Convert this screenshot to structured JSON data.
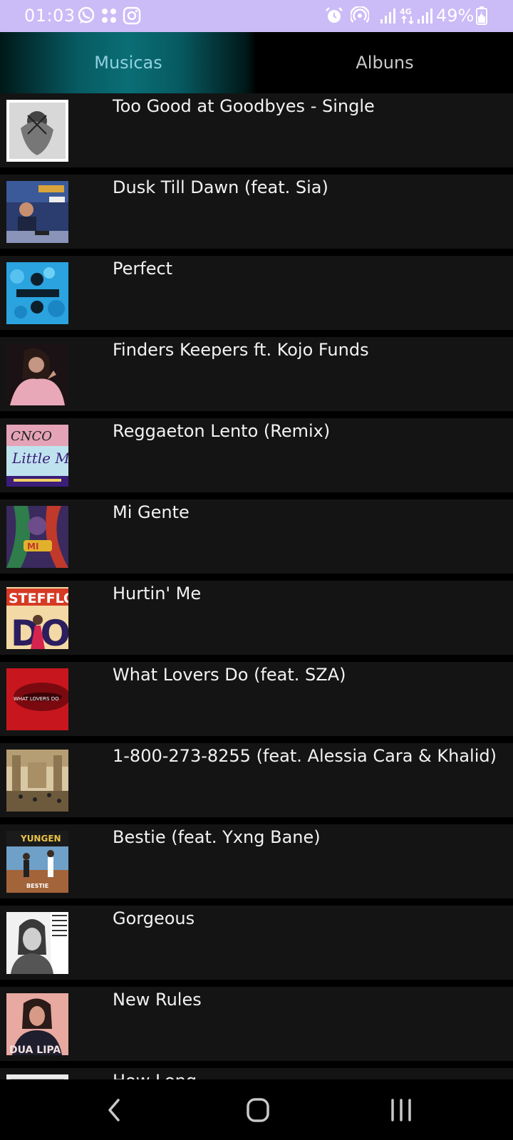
{
  "status_bar": {
    "time": "01:03",
    "battery": "49%",
    "icons": [
      "whatsapp-icon",
      "apps-icon",
      "instagram-icon",
      "alarm-icon",
      "hotspot-icon",
      "signal-icon",
      "4g-icon",
      "signal-icon",
      "battery-icon"
    ]
  },
  "tabs": [
    {
      "label": "Musicas",
      "selected": true
    },
    {
      "label": "Albuns",
      "selected": false
    }
  ],
  "songs": [
    {
      "title": "Too Good at Goodbyes - Single"
    },
    {
      "title": "Dusk Till Dawn (feat. Sia)"
    },
    {
      "title": "Perfect"
    },
    {
      "title": "Finders Keepers ft. Kojo Funds"
    },
    {
      "title": "Reggaeton Lento (Remix)"
    },
    {
      "title": "Mi Gente"
    },
    {
      "title": "Hurtin' Me"
    },
    {
      "title": "What Lovers Do (feat. SZA)"
    },
    {
      "title": "1-800-273-8255 (feat. Alessia Cara & Khalid)"
    },
    {
      "title": "Bestie (feat. Yxng Bane)"
    },
    {
      "title": "Gorgeous"
    },
    {
      "title": "New Rules"
    },
    {
      "title": "How Long"
    }
  ],
  "colors": {
    "status_bar_bg": "#cbbbf6",
    "selected_tab_text": "#8fd0e0",
    "row_bg": "#141414"
  },
  "nav_bar": {
    "icons": [
      "back-icon",
      "home-icon",
      "recents-icon"
    ]
  }
}
